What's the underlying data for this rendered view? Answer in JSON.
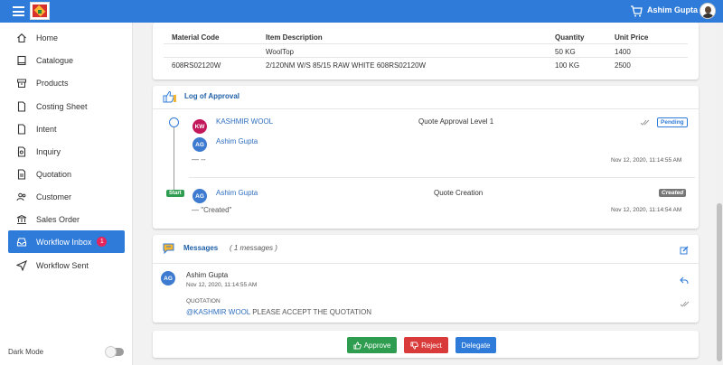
{
  "header": {
    "user_name": "Ashim Gupta"
  },
  "sidebar": {
    "items": [
      {
        "label": "Home",
        "icon": "home-icon"
      },
      {
        "label": "Catalogue",
        "icon": "book-icon"
      },
      {
        "label": "Products",
        "icon": "box-icon"
      },
      {
        "label": "Costing Sheet",
        "icon": "document-icon"
      },
      {
        "label": "Intent",
        "icon": "document-icon"
      },
      {
        "label": "Inquiry",
        "icon": "search-document-icon"
      },
      {
        "label": "Quotation",
        "icon": "document-icon"
      },
      {
        "label": "Customer",
        "icon": "users-icon"
      },
      {
        "label": "Sales Order",
        "icon": "bank-icon"
      },
      {
        "label": "Workflow Inbox",
        "icon": "inbox-icon",
        "badge": "1",
        "active": true
      },
      {
        "label": "Workflow Sent",
        "icon": "send-icon"
      }
    ],
    "dark_mode_label": "Dark Mode"
  },
  "items_table": {
    "headers": [
      "Material Code",
      "Item Description",
      "Quantity",
      "Unit Price"
    ],
    "rows": [
      [
        "",
        "WoolTop",
        "50 KG",
        "1400"
      ],
      [
        "608RS02120W",
        "2/120NM W/S 85/15 RAW WHITE 608RS02120W",
        "100 KG",
        "2500"
      ]
    ]
  },
  "approval_log": {
    "title": "Log of Approval",
    "entries": [
      {
        "initials": "KW",
        "name": "KASHMIR WOOL",
        "action": "Quote Approval Level 1",
        "status": "Pending",
        "sub_initials": "AG",
        "sub_name": "Ashim Gupta",
        "comment": "— --",
        "time": "Nov 12, 2020, 11:14:55 AM"
      },
      {
        "marker": "Start",
        "initials": "AG",
        "name": "Ashim Gupta",
        "action": "Quote Creation",
        "status": "Created",
        "comment": "— \"Created\"",
        "time": "Nov 12, 2020, 11:14:54 AM"
      }
    ]
  },
  "messages": {
    "title": "Messages",
    "count_label": "( 1 messages )",
    "items": [
      {
        "initials": "AG",
        "author": "Ashim Gupta",
        "time": "Nov 12, 2020, 11:14:55 AM",
        "type": "QUOTATION",
        "mention": "@KASHMIR WOOL",
        "text": "PLEASE ACCEPT THE QUOTATION"
      }
    ]
  },
  "actions": {
    "approve": "Approve",
    "reject": "Reject",
    "delegate": "Delegate"
  },
  "colors": {
    "primary": "#2f7bd9",
    "approve": "#2e9d4f",
    "reject": "#d93a3a",
    "delegate": "#2f7bd9",
    "badge": "#e5245b",
    "avatar_kw": "#c2185b",
    "avatar_ag": "#3d7bd0"
  }
}
